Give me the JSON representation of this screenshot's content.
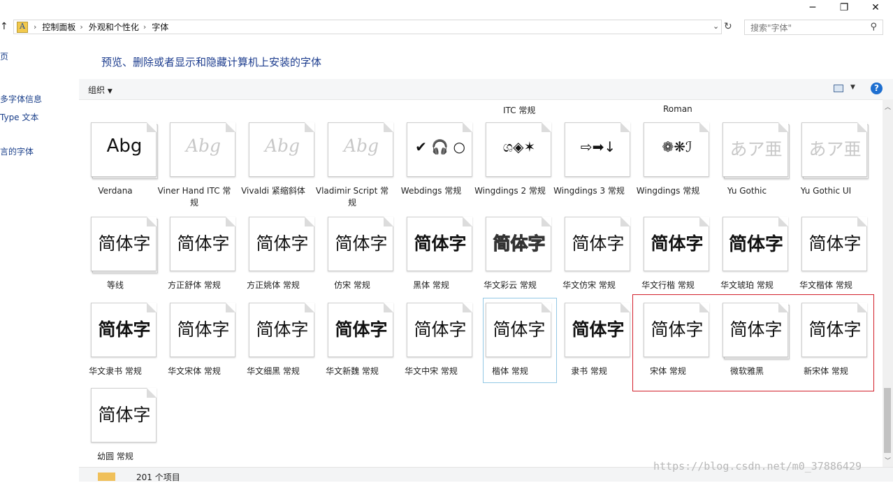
{
  "window": {
    "minimize_label": "─",
    "maximize_label": "❐",
    "close_label": "✕"
  },
  "breadcrumb": {
    "items": [
      "控制面板",
      "外观和个性化",
      "字体"
    ]
  },
  "search": {
    "placeholder": "搜索\"字体\""
  },
  "nav": {
    "items": [
      "页",
      "多字体信息",
      "Type 文本",
      "言的字体"
    ]
  },
  "heading": "预览、删除或者显示和隐藏计算机上安装的字体",
  "toolbar": {
    "organize_label": "组织"
  },
  "partial_labels": [
    "ITC 常规",
    "Roman"
  ],
  "fonts": [
    {
      "sample": "Abg",
      "label": "Verdana",
      "style": "normal",
      "stack": true
    },
    {
      "sample": "Abg",
      "label": "Viner Hand ITC 常规",
      "style": "light-italic",
      "stack": false
    },
    {
      "sample": "Abg",
      "label": "Vivaldi 紧缩斜体",
      "style": "light-italic",
      "stack": false
    },
    {
      "sample": "Abg",
      "label": "Vladimir Script 常规",
      "style": "light-italic",
      "stack": false
    },
    {
      "sample": "✔ 🎧 ○",
      "label": "Webdings 常规",
      "style": "symbol",
      "stack": false
    },
    {
      "sample": "ශ◈✶",
      "label": "Wingdings 2 常规",
      "style": "symbol",
      "stack": false
    },
    {
      "sample": "⇨➡↓",
      "label": "Wingdings 3 常规",
      "style": "symbol",
      "stack": false
    },
    {
      "sample": "❁❋ℐ",
      "label": "Wingdings 常规",
      "style": "symbol",
      "stack": false
    },
    {
      "sample": "あア亜",
      "label": "Yu Gothic",
      "style": "light",
      "stack": true
    },
    {
      "sample": "あア亜",
      "label": "Yu Gothic UI",
      "style": "light",
      "stack": true
    },
    {
      "sample": "简体字",
      "label": "等线",
      "style": "normal",
      "stack": true
    },
    {
      "sample": "简体字",
      "label": "方正舒体 常规",
      "style": "normal",
      "stack": false
    },
    {
      "sample": "简体字",
      "label": "方正姚体 常规",
      "style": "normal",
      "stack": false
    },
    {
      "sample": "简体字",
      "label": "仿宋 常规",
      "style": "normal",
      "stack": false
    },
    {
      "sample": "简体字",
      "label": "黑体 常规",
      "style": "bold",
      "stack": false
    },
    {
      "sample": "简体字",
      "label": "华文彩云 常规",
      "style": "outline",
      "stack": false
    },
    {
      "sample": "简体字",
      "label": "华文仿宋 常规",
      "style": "normal",
      "stack": false
    },
    {
      "sample": "简体字",
      "label": "华文行楷 常规",
      "style": "bold",
      "stack": false
    },
    {
      "sample": "简体字",
      "label": "华文琥珀 常规",
      "style": "heavy",
      "stack": false
    },
    {
      "sample": "简体字",
      "label": "华文楷体 常规",
      "style": "normal",
      "stack": false
    },
    {
      "sample": "简体字",
      "label": "华文隶书 常规",
      "style": "bold",
      "stack": false
    },
    {
      "sample": "简体字",
      "label": "华文宋体 常规",
      "style": "normal",
      "stack": false
    },
    {
      "sample": "简体字",
      "label": "华文细黑 常规",
      "style": "normal",
      "stack": false
    },
    {
      "sample": "简体字",
      "label": "华文新魏 常规",
      "style": "bold",
      "stack": false
    },
    {
      "sample": "简体字",
      "label": "华文中宋 常规",
      "style": "normal",
      "stack": false
    },
    {
      "sample": "简体字",
      "label": "楷体 常规",
      "style": "normal",
      "stack": false
    },
    {
      "sample": "简体字",
      "label": "隶书 常规",
      "style": "bold",
      "stack": false
    },
    {
      "sample": "简体字",
      "label": "宋体 常规",
      "style": "normal",
      "stack": false
    },
    {
      "sample": "简体字",
      "label": "微软雅黑",
      "style": "normal",
      "stack": true
    },
    {
      "sample": "简体字",
      "label": "新宋体 常规",
      "style": "normal",
      "stack": false
    },
    {
      "sample": "简体字",
      "label": "幼圆 常规",
      "style": "normal",
      "stack": false
    }
  ],
  "status": {
    "count_label": "201 个项目"
  },
  "watermark": "https://blog.csdn.net/m0_37886429"
}
